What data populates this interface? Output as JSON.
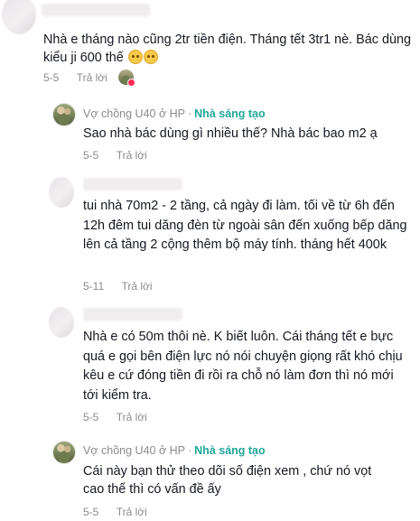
{
  "comments": [
    {
      "text": "Nhà e tháng nào cũng 2tr tiền điện. Tháng tết 3tr1 nè. Bác dùng kiểu ji 600 thế",
      "emoji": [
        "pleading-face-emoji",
        "pleading-face-emoji"
      ],
      "date": "5-5",
      "reply_label": "Trả lời",
      "liked_by_creator": true
    },
    {
      "author": "Vợ chồng U40 ở HP",
      "separator": "·",
      "badge": "Nhà sáng tạo",
      "text": "Sao nhà bác dùng gì nhiều thế? Nhà bác bao m2 ạ",
      "date": "5-5",
      "reply_label": "Trả lời"
    },
    {
      "text": "tui nhà 70m2 - 2 tầng, cả ngày đi làm. tối về từ 6h đến 12h đêm tui dăng đèn từ ngoài sân đến xuống bếp dăng lên cả tầng 2 cộng thêm bộ máy tính. tháng hết 400k",
      "date": "5-11",
      "reply_label": "Trả lời"
    },
    {
      "text": "Nhà e có 50m thôi nè. K biết luôn. Cái tháng tết e bực quá e gọi bên điện lực nó nói chuyện giọng rất khó chịu kêu e cứ đóng tiền đi rồi ra chỗ nó làm đơn thì nó mới tới kiểm tra.",
      "date": "5-5",
      "reply_label": "Trả lời"
    },
    {
      "author": "Vợ chồng U40 ở HP",
      "separator": "·",
      "badge": "Nhà sáng tạo",
      "text": "Cái này bạn thử theo dõi số điện xem , chứ nó vọt cao thế thì có vấn đề ấy",
      "date": "5-5",
      "reply_label": "Trả lời"
    }
  ],
  "colors": {
    "text": "#161823",
    "meta": "#8a8b91",
    "creator_badge": "#20a79a",
    "heart": "#fe2c55"
  }
}
